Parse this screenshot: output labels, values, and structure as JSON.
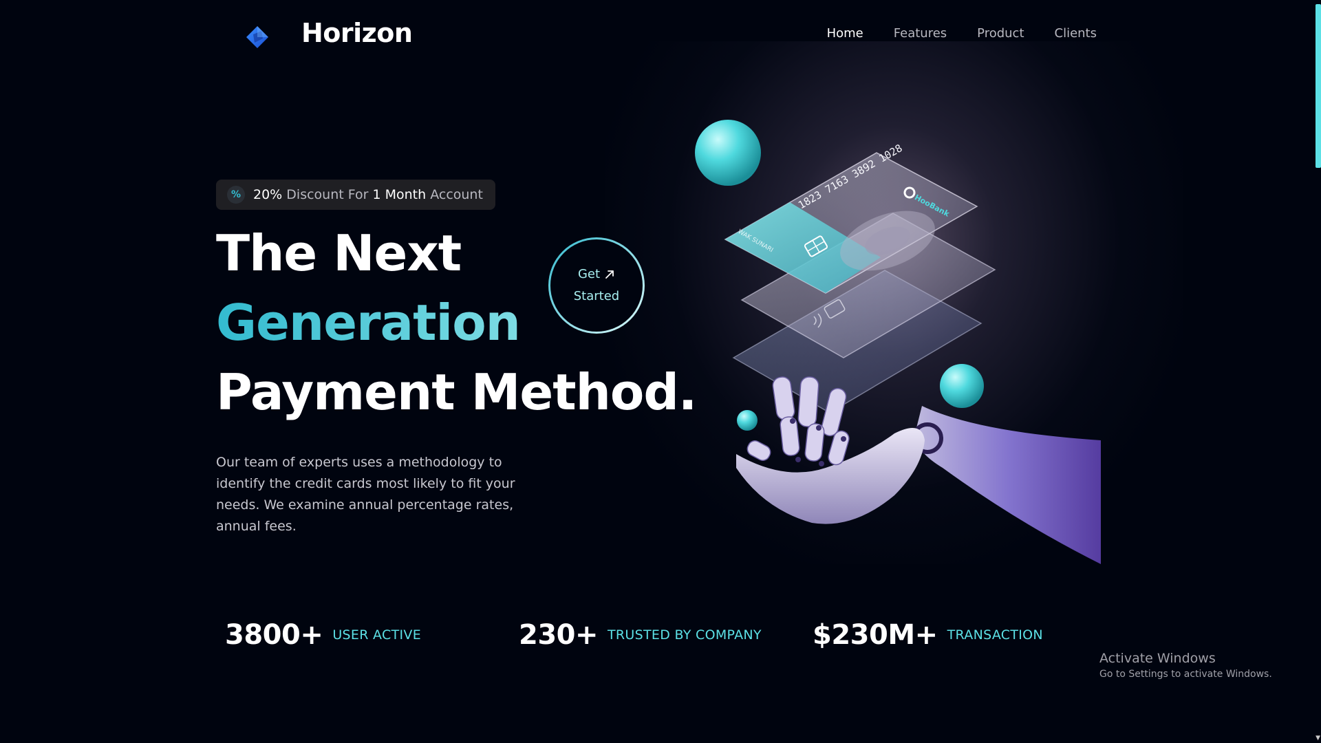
{
  "brand": {
    "name": "Horizon",
    "logo_icon": "diamond-logo-icon"
  },
  "nav": {
    "items": [
      {
        "label": "Home",
        "active": true
      },
      {
        "label": "Features",
        "active": false
      },
      {
        "label": "Product",
        "active": false
      },
      {
        "label": "Clients",
        "active": false
      }
    ]
  },
  "hero": {
    "badge": {
      "icon": "discount-percent-icon",
      "percent": "20%",
      "text_1": "Discount For",
      "strong_2": "1 Month",
      "text_3": "Account"
    },
    "title": {
      "line1": "The Next",
      "line2": "Generation",
      "line3": "Payment Method."
    },
    "description": "Our team of experts uses a methodology to identify the credit cards most likely to fit your needs. We examine annual percentage rates, annual fees.",
    "cta": {
      "line1": "Get",
      "line2": "Started",
      "icon": "arrow-up-right-icon"
    },
    "card": {
      "number": "1823 7163 3892 1028",
      "bank": "HooBank",
      "holder": "WAK SUNARI"
    }
  },
  "stats": [
    {
      "value": "3800+",
      "label": "USER ACTIVE"
    },
    {
      "value": "230+",
      "label": "TRUSTED BY COMPANY"
    },
    {
      "value": "$230M+",
      "label": "TRANSACTION"
    }
  ],
  "watermark": {
    "title": "Activate Windows",
    "subtitle": "Go to Settings to activate Windows."
  },
  "colors": {
    "background": "#00040f",
    "accent": "#33bbcf",
    "accent_light": "#a8eff0",
    "stat_label": "#5ce1e6"
  }
}
